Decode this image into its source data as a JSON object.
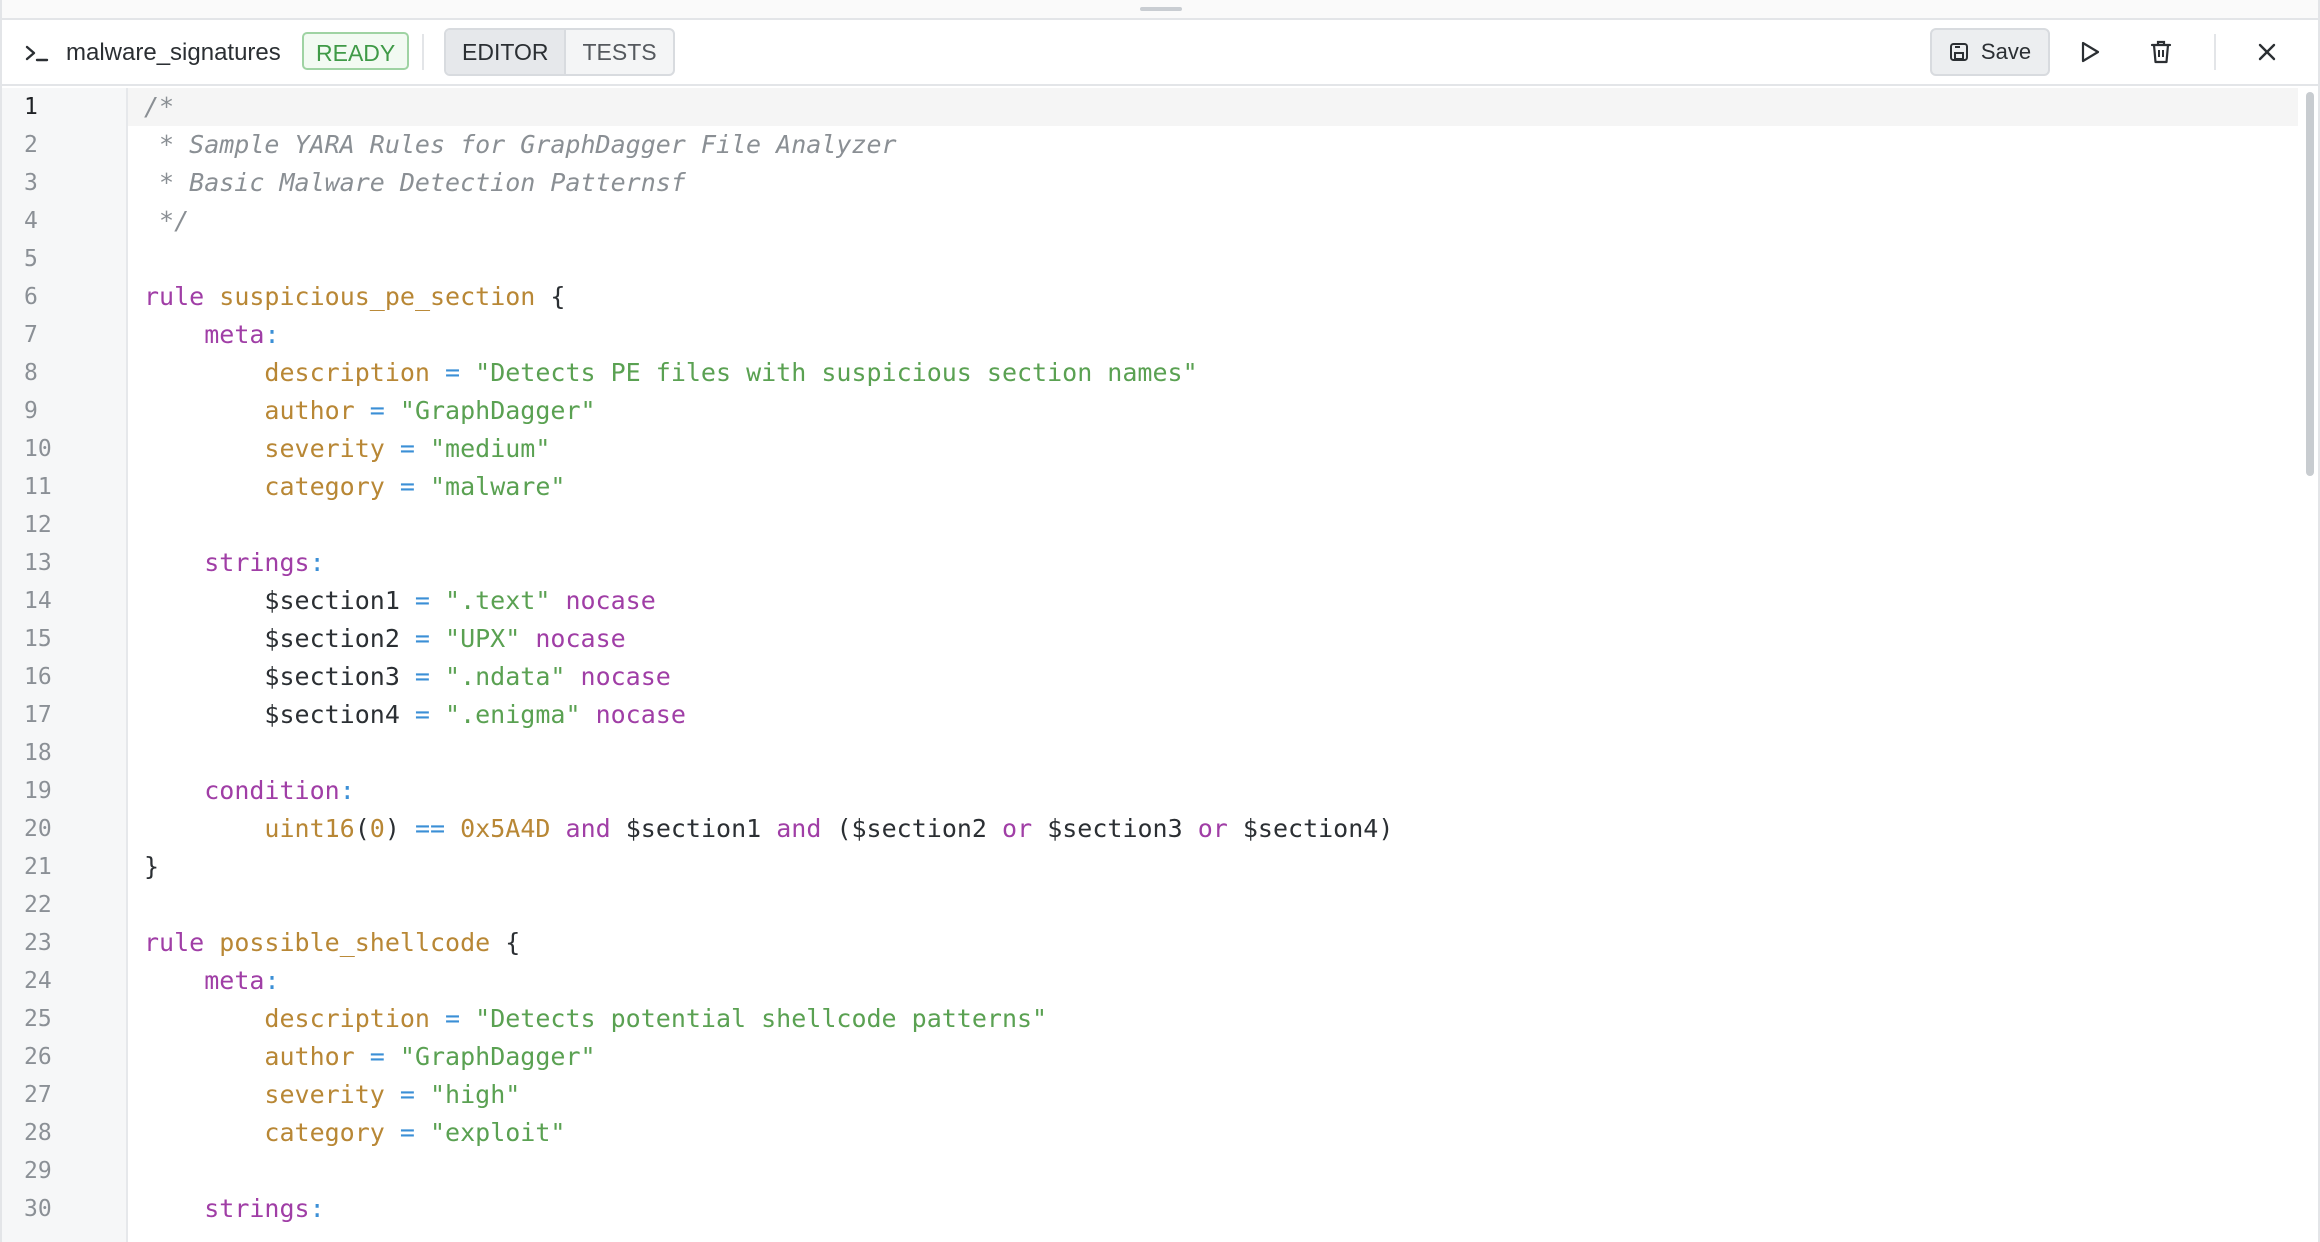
{
  "toolbar": {
    "terminal_icon": "terminal-prompt-icon",
    "filename": "malware_signatures",
    "status": "READY",
    "tabs": [
      {
        "label": "EDITOR",
        "active": true
      },
      {
        "label": "TESTS",
        "active": false
      }
    ],
    "save_label": "Save",
    "save_icon": "save-disk-icon",
    "run_icon": "play-icon",
    "delete_icon": "trash-icon",
    "close_icon": "close-icon"
  },
  "editor": {
    "current_line": 1,
    "lines": [
      [
        [
          "c",
          "/*"
        ]
      ],
      [
        [
          "c",
          " * Sample YARA Rules for GraphDagger File Analyzer"
        ]
      ],
      [
        [
          "c",
          " * Basic Malware Detection Patternsf"
        ]
      ],
      [
        [
          "c",
          " */"
        ]
      ],
      [],
      [
        [
          "k",
          "rule"
        ],
        [
          "p",
          " "
        ],
        [
          "n",
          "suspicious_pe_section"
        ],
        [
          "p",
          " {"
        ]
      ],
      [
        [
          "p",
          "    "
        ],
        [
          "k",
          "meta"
        ],
        [
          "o",
          ":"
        ]
      ],
      [
        [
          "p",
          "        "
        ],
        [
          "n",
          "description"
        ],
        [
          "o",
          " = "
        ],
        [
          "s",
          "\"Detects PE files with suspicious section names\""
        ]
      ],
      [
        [
          "p",
          "        "
        ],
        [
          "n",
          "author"
        ],
        [
          "o",
          " = "
        ],
        [
          "s",
          "\"GraphDagger\""
        ]
      ],
      [
        [
          "p",
          "        "
        ],
        [
          "n",
          "severity"
        ],
        [
          "o",
          " = "
        ],
        [
          "s",
          "\"medium\""
        ]
      ],
      [
        [
          "p",
          "        "
        ],
        [
          "n",
          "category"
        ],
        [
          "o",
          " = "
        ],
        [
          "s",
          "\"malware\""
        ]
      ],
      [],
      [
        [
          "p",
          "    "
        ],
        [
          "k",
          "strings"
        ],
        [
          "o",
          ":"
        ]
      ],
      [
        [
          "p",
          "        $section1"
        ],
        [
          "o",
          " = "
        ],
        [
          "s",
          "\".text\""
        ],
        [
          "p",
          " "
        ],
        [
          "k",
          "nocase"
        ]
      ],
      [
        [
          "p",
          "        $section2"
        ],
        [
          "o",
          " = "
        ],
        [
          "s",
          "\"UPX\""
        ],
        [
          "p",
          " "
        ],
        [
          "k",
          "nocase"
        ]
      ],
      [
        [
          "p",
          "        $section3"
        ],
        [
          "o",
          " = "
        ],
        [
          "s",
          "\".ndata\""
        ],
        [
          "p",
          " "
        ],
        [
          "k",
          "nocase"
        ]
      ],
      [
        [
          "p",
          "        $section4"
        ],
        [
          "o",
          " = "
        ],
        [
          "s",
          "\".enigma\""
        ],
        [
          "p",
          " "
        ],
        [
          "k",
          "nocase"
        ]
      ],
      [],
      [
        [
          "p",
          "    "
        ],
        [
          "k",
          "condition"
        ],
        [
          "o",
          ":"
        ]
      ],
      [
        [
          "p",
          "        "
        ],
        [
          "n",
          "uint16"
        ],
        [
          "p",
          "("
        ],
        [
          "n",
          "0"
        ],
        [
          "p",
          ") "
        ],
        [
          "o",
          "=="
        ],
        [
          "p",
          " "
        ],
        [
          "n",
          "0x5A4D"
        ],
        [
          "p",
          " "
        ],
        [
          "k",
          "and"
        ],
        [
          "p",
          " $section1 "
        ],
        [
          "k",
          "and"
        ],
        [
          "p",
          " ($section2 "
        ],
        [
          "k",
          "or"
        ],
        [
          "p",
          " $section3 "
        ],
        [
          "k",
          "or"
        ],
        [
          "p",
          " $section4)"
        ]
      ],
      [
        [
          "p",
          "}"
        ]
      ],
      [],
      [
        [
          "k",
          "rule"
        ],
        [
          "p",
          " "
        ],
        [
          "n",
          "possible_shellcode"
        ],
        [
          "p",
          " {"
        ]
      ],
      [
        [
          "p",
          "    "
        ],
        [
          "k",
          "meta"
        ],
        [
          "o",
          ":"
        ]
      ],
      [
        [
          "p",
          "        "
        ],
        [
          "n",
          "description"
        ],
        [
          "o",
          " = "
        ],
        [
          "s",
          "\"Detects potential shellcode patterns\""
        ]
      ],
      [
        [
          "p",
          "        "
        ],
        [
          "n",
          "author"
        ],
        [
          "o",
          " = "
        ],
        [
          "s",
          "\"GraphDagger\""
        ]
      ],
      [
        [
          "p",
          "        "
        ],
        [
          "n",
          "severity"
        ],
        [
          "o",
          " = "
        ],
        [
          "s",
          "\"high\""
        ]
      ],
      [
        [
          "p",
          "        "
        ],
        [
          "n",
          "category"
        ],
        [
          "o",
          " = "
        ],
        [
          "s",
          "\"exploit\""
        ]
      ],
      [],
      [
        [
          "p",
          "    "
        ],
        [
          "k",
          "strings"
        ],
        [
          "o",
          ":"
        ]
      ]
    ]
  }
}
